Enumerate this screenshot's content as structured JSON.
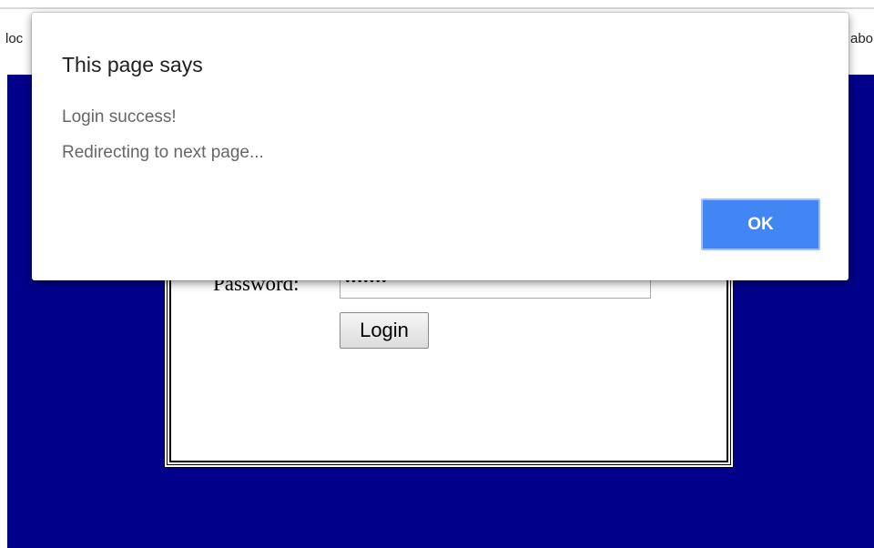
{
  "bookmarks": {
    "left_fragment": "loc",
    "right_fragment": "abo"
  },
  "login_form": {
    "password_label": "Password:",
    "password_value": "•••••••",
    "login_button_label": "Login"
  },
  "dialog": {
    "title": "This page says",
    "message_line1": "Login success!",
    "message_line2": "Redirecting to next page...",
    "ok_label": "OK"
  },
  "colors": {
    "page_background": "#00008b",
    "ok_button": "#4285f4",
    "dialog_message_text": "#666666"
  }
}
